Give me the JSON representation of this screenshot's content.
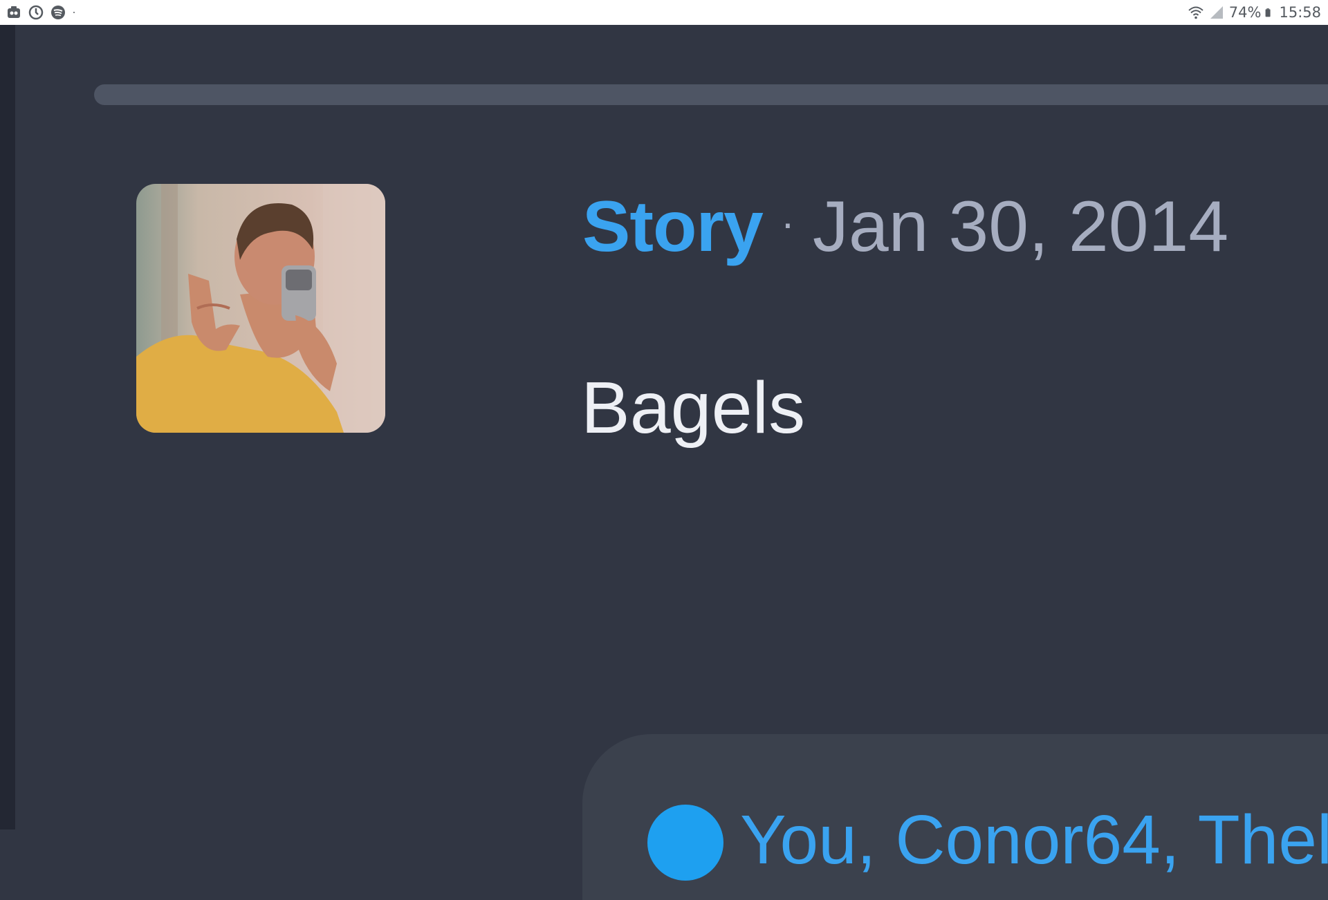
{
  "status_bar": {
    "battery": "74%",
    "time": "15:58",
    "left_icons": [
      "notification-app-icon",
      "sync-icon",
      "spotify-icon",
      "dot-icon"
    ],
    "right_icons": [
      "wifi-icon",
      "signal-icon",
      "battery-icon"
    ]
  },
  "post": {
    "type_label": "Story",
    "separator": "·",
    "date": "Jan 30, 2014",
    "title": "Bagels"
  },
  "card": {
    "text": "You, Conor64, Thel"
  },
  "colors": {
    "background": "#313643",
    "accent": "#3aa3f0",
    "muted": "#a6adc0",
    "title": "#eef0f5",
    "card": "#3b414d"
  }
}
